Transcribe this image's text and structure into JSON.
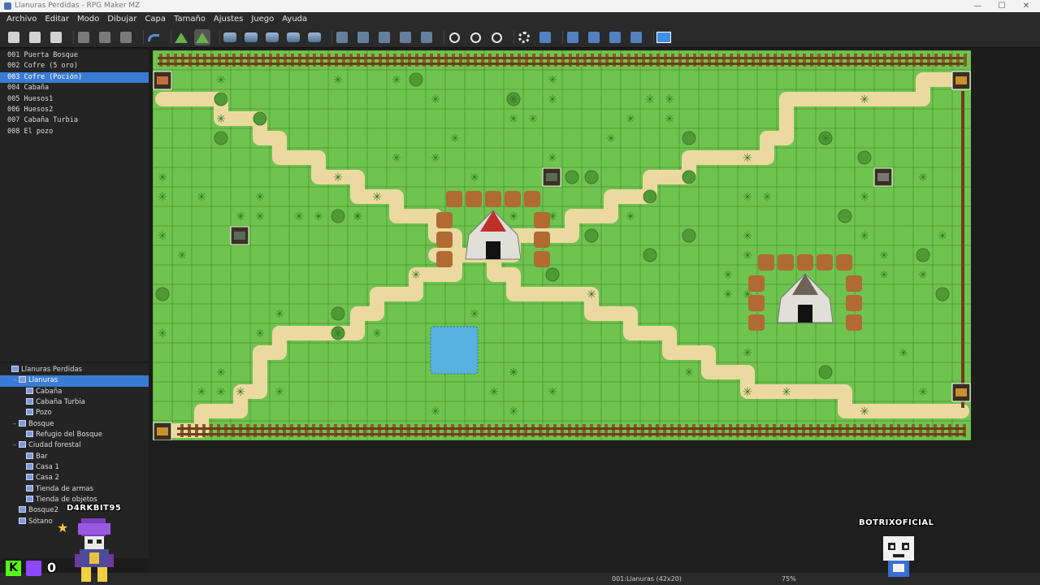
{
  "window": {
    "title": "Llanuras Perdidas - RPG Maker MZ"
  },
  "menu": [
    "Archivo",
    "Editar",
    "Modo",
    "Dibujar",
    "Capa",
    "Tamaño",
    "Ajustes",
    "Juego",
    "Ayuda"
  ],
  "toolbar": [
    {
      "name": "new-project",
      "icon": "new-file-icon"
    },
    {
      "name": "open-project",
      "icon": "folder-open-icon"
    },
    {
      "name": "save-project",
      "icon": "save-icon"
    },
    {
      "name": "cut",
      "icon": "scissors-icon"
    },
    {
      "name": "copy",
      "icon": "copy-icon"
    },
    {
      "name": "paste",
      "icon": "paste-icon"
    },
    {
      "name": "undo",
      "icon": "undo-icon"
    },
    {
      "name": "map-mode",
      "icon": "map-icon"
    },
    {
      "name": "event-mode",
      "icon": "event-icon",
      "active": true
    },
    {
      "name": "layer-1",
      "icon": "layer-icon"
    },
    {
      "name": "layer-2",
      "icon": "layer-icon"
    },
    {
      "name": "layer-3",
      "icon": "layer-icon"
    },
    {
      "name": "layer-4",
      "icon": "layer-icon"
    },
    {
      "name": "layer-auto",
      "icon": "layer-icon"
    },
    {
      "name": "pencil",
      "icon": "pencil-icon"
    },
    {
      "name": "rectangle",
      "icon": "rectangle-icon"
    },
    {
      "name": "ellipse",
      "icon": "ellipse-icon"
    },
    {
      "name": "fill",
      "icon": "fill-icon"
    },
    {
      "name": "shadow-pen",
      "icon": "shadow-pen-icon"
    },
    {
      "name": "zoom-in",
      "icon": "zoom-in-icon"
    },
    {
      "name": "zoom-out",
      "icon": "zoom-out-icon"
    },
    {
      "name": "zoom-actual",
      "icon": "zoom-actual-icon"
    },
    {
      "name": "database",
      "icon": "gear-icon"
    },
    {
      "name": "plugin-manager",
      "icon": "plugin-icon"
    },
    {
      "name": "sound-test",
      "icon": "speaker-icon"
    },
    {
      "name": "event-searcher",
      "icon": "search-window-icon"
    },
    {
      "name": "resource-manager",
      "icon": "resource-icon"
    },
    {
      "name": "character-generator",
      "icon": "character-icon"
    },
    {
      "name": "playtest",
      "icon": "play-icon"
    }
  ],
  "events": [
    {
      "label": "001 Puerta Bosque"
    },
    {
      "label": "002 Cofre (5 oro)"
    },
    {
      "label": "003 Cofre (Poción)",
      "selected": true
    },
    {
      "label": "004 Cabaña"
    },
    {
      "label": "005 Huesos1"
    },
    {
      "label": "006 Huesos2"
    },
    {
      "label": "007 Cabaña Turbia"
    },
    {
      "label": "008 El pozo"
    }
  ],
  "maptree": [
    {
      "label": "Llanuras Perdidas",
      "depth": 0,
      "toggle": ""
    },
    {
      "label": "Llanuras",
      "depth": 1,
      "toggle": "−",
      "selected": true
    },
    {
      "label": "Cabaña",
      "depth": 2,
      "toggle": ""
    },
    {
      "label": "Cabaña Turbia",
      "depth": 2,
      "toggle": ""
    },
    {
      "label": "Pozo",
      "depth": 2,
      "toggle": ""
    },
    {
      "label": "Bosque",
      "depth": 1,
      "toggle": "−"
    },
    {
      "label": "Refugio del Bosque",
      "depth": 2,
      "toggle": ""
    },
    {
      "label": "Ciudad forestal",
      "depth": 1,
      "toggle": "−"
    },
    {
      "label": "Bar",
      "depth": 2,
      "toggle": ""
    },
    {
      "label": "Casa 1",
      "depth": 2,
      "toggle": ""
    },
    {
      "label": "Casa 2",
      "depth": 2,
      "toggle": ""
    },
    {
      "label": "Tienda de armas",
      "depth": 2,
      "toggle": ""
    },
    {
      "label": "Tienda de objetos",
      "depth": 2,
      "toggle": ""
    },
    {
      "label": "Bosque2",
      "depth": 1,
      "toggle": ""
    },
    {
      "label": "Sótano",
      "depth": 1,
      "toggle": ""
    }
  ],
  "status": {
    "map": "001:Llanuras (42x20)",
    "zoom": "75%"
  },
  "overlays": {
    "streamer1": "D4RKBIT95",
    "streamer2": "BOTRIXOFICIAL",
    "counter": "0"
  },
  "colors": {
    "grass": "#6fc44f",
    "path": "#ecd9a0",
    "water": "#58b3e0",
    "selection": "#3a7bd5",
    "fence": "#8a5a2b"
  }
}
